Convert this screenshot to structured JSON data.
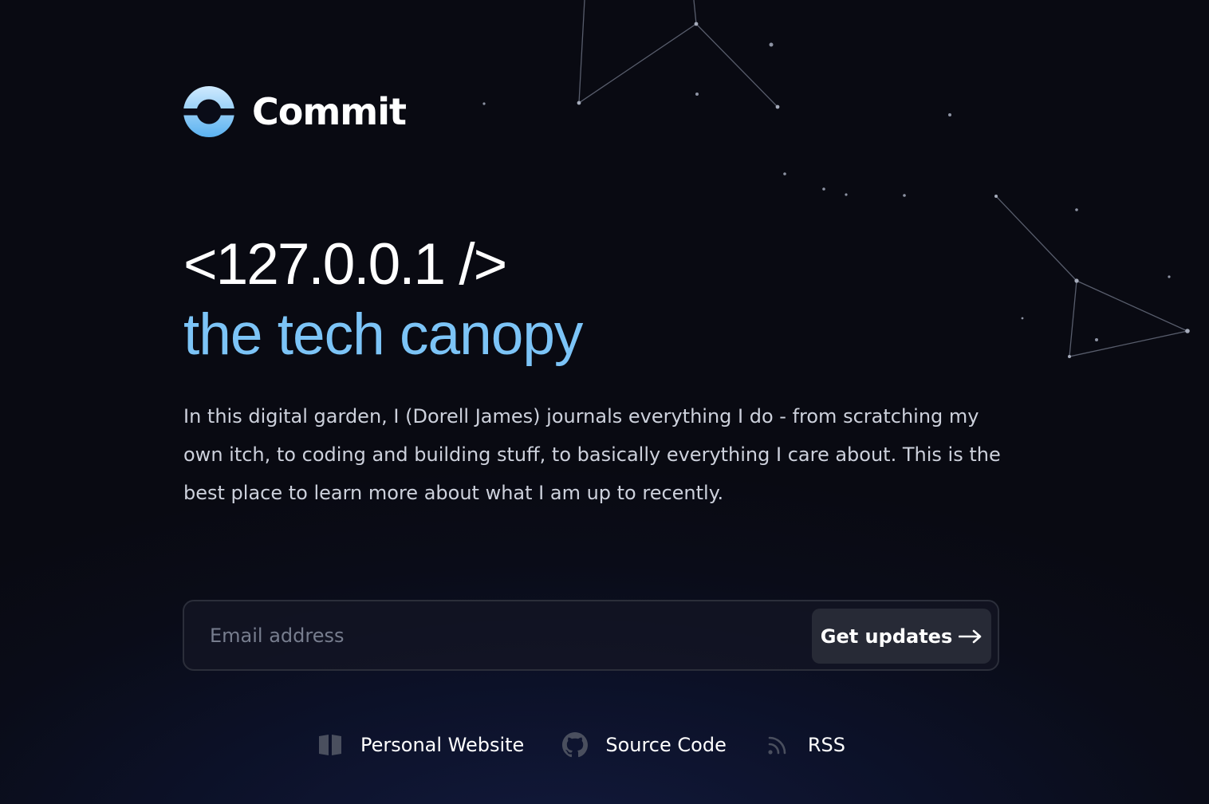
{
  "brand": {
    "name": "Commit",
    "logo_icon": "commit-ring-logo",
    "accent": "#7cc4f7"
  },
  "hero": {
    "line1": "<127.0.0.1 />",
    "line2": "the tech canopy"
  },
  "intro": "In this digital garden, I (Dorell James) journals everything I do - from scratching my own itch, to coding and building stuff, to basically everything I care about. This is the best place to learn more about what I am up to recently.",
  "signup": {
    "email_placeholder": "Email address",
    "button_label": "Get updates",
    "button_icon": "arrow-right-icon"
  },
  "links": [
    {
      "label": "Personal Website",
      "icon": "book-icon"
    },
    {
      "label": "Source Code",
      "icon": "github-icon"
    },
    {
      "label": "RSS",
      "icon": "rss-icon"
    }
  ],
  "colors": {
    "background": "#0a0c18",
    "text": "#ffffff",
    "body_text": "#cdd1dc",
    "field_border": "#2b2e3a",
    "button_bg": "#272a36"
  }
}
